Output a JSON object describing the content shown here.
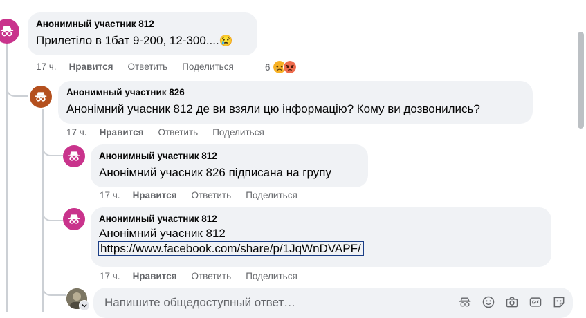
{
  "comments": [
    {
      "author": "Анонимный участник 812",
      "text": "Прилетіло в 1бат 9-200, 12-300....",
      "text_emoji": "😢",
      "time": "17 ч.",
      "like": "Нравится",
      "reply": "Ответить",
      "share": "Поделиться",
      "reactions_count": "6",
      "avatar_color": "#c9338c"
    },
    {
      "author": "Анонимный участник 826",
      "text": "Анонімний учасник 812 де ви взяли цю інформацію? Кому ви дозвонились?",
      "time": "17 ч.",
      "like": "Нравится",
      "reply": "Ответить",
      "share": "Поделиться",
      "avatar_color": "#b4501e"
    },
    {
      "author": "Анонимный участник 812",
      "text": "Анонімний учасник 826 підписана на групу",
      "time": "17 ч.",
      "like": "Нравится",
      "reply": "Ответить",
      "share": "Поделиться",
      "avatar_color": "#c9338c"
    },
    {
      "author": "Анонимный участник 812",
      "text": "Анонімний учасник 812",
      "link": "https://www.facebook.com/share/p/1JqWnDVAPF/",
      "time": "17 ч.",
      "like": "Нравится",
      "reply": "Ответить",
      "share": "Поделиться",
      "avatar_color": "#c9338c"
    }
  ],
  "composer": {
    "placeholder": "Напишите общедоступный ответ…",
    "tools": [
      "anonymous-icon",
      "smiley-icon",
      "camera-icon",
      "gif-icon",
      "sticker-icon"
    ]
  }
}
